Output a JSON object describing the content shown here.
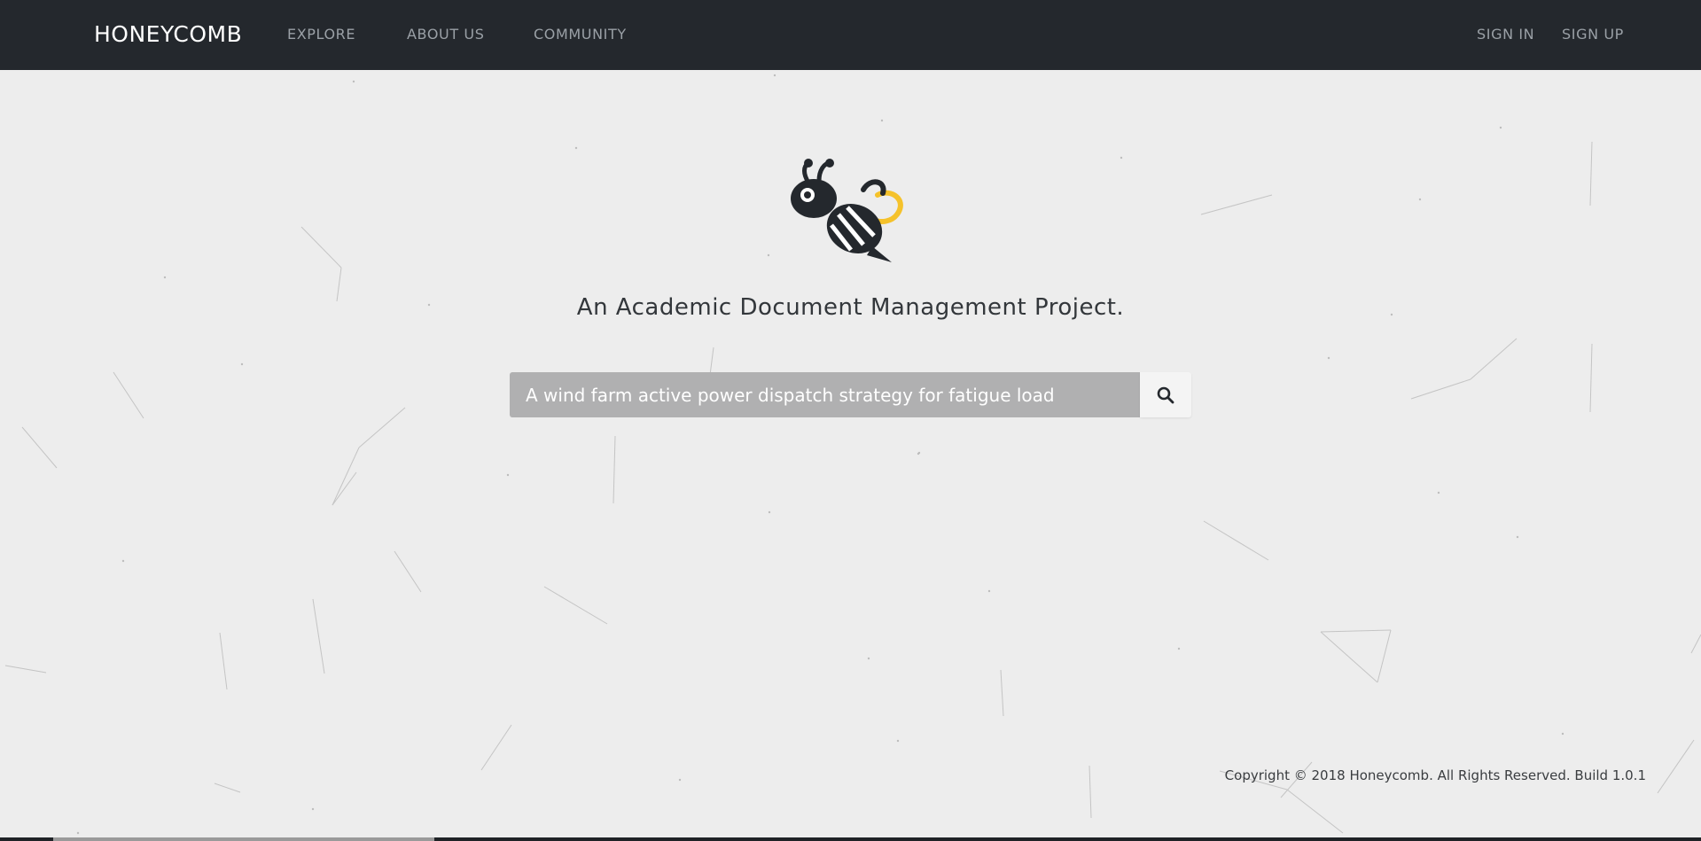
{
  "nav": {
    "brand": "HONEYCOMB",
    "links": [
      "EXPLORE",
      "ABOUT US",
      "COMMUNITY"
    ],
    "auth": [
      "SIGN IN",
      "SIGN UP"
    ]
  },
  "hero": {
    "logo_icon": "bee-icon",
    "tagline": "An Academic Document Management Project."
  },
  "search": {
    "value": "A wind farm active power dispatch strategy for fatigue load",
    "button_icon": "search-icon"
  },
  "footer": {
    "copyright": "Copyright © 2018 Honeycomb. All Rights Reserved. Build 1.0.1"
  },
  "colors": {
    "navbar": "#24282d",
    "background": "#ededed",
    "accent_yellow": "#f5c22b",
    "search_field": "#b0b0b1"
  }
}
